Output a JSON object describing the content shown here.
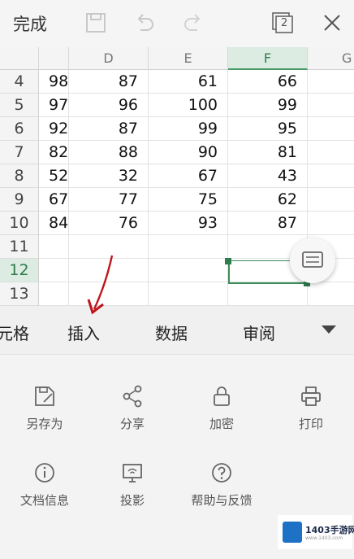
{
  "toolbar": {
    "done_label": "完成",
    "page_count": "2",
    "icons": [
      "save-icon",
      "undo-icon",
      "redo-icon",
      "pages-icon",
      "close-icon"
    ]
  },
  "sheet": {
    "columns": [
      "",
      "D",
      "E",
      "F",
      "G"
    ],
    "selected_column": "F",
    "selected_row": "12",
    "rows": [
      {
        "num": "4",
        "c": "98",
        "d": "87",
        "e": "61",
        "f": "66"
      },
      {
        "num": "5",
        "c": "97",
        "d": "96",
        "e": "100",
        "f": "99"
      },
      {
        "num": "6",
        "c": "92",
        "d": "87",
        "e": "99",
        "f": "95"
      },
      {
        "num": "7",
        "c": "82",
        "d": "88",
        "e": "90",
        "f": "81"
      },
      {
        "num": "8",
        "c": "52",
        "d": "32",
        "e": "67",
        "f": "43"
      },
      {
        "num": "9",
        "c": "67",
        "d": "77",
        "e": "75",
        "f": "62"
      },
      {
        "num": "10",
        "c": "84",
        "d": "76",
        "e": "93",
        "f": "87"
      },
      {
        "num": "11",
        "c": "",
        "d": "",
        "e": "",
        "f": ""
      },
      {
        "num": "12",
        "c": "",
        "d": "",
        "e": "",
        "f": ""
      },
      {
        "num": "13",
        "c": "",
        "d": "",
        "e": "",
        "f": ""
      }
    ]
  },
  "tabs": [
    "元格",
    "插入",
    "数据",
    "审阅"
  ],
  "menu": {
    "items": [
      {
        "label": "另存为",
        "icon": "save-as-icon"
      },
      {
        "label": "分享",
        "icon": "share-icon"
      },
      {
        "label": "加密",
        "icon": "lock-icon"
      },
      {
        "label": "打印",
        "icon": "print-icon"
      },
      {
        "label": "文档信息",
        "icon": "info-icon"
      },
      {
        "label": "投影",
        "icon": "projection-icon"
      },
      {
        "label": "帮助与反馈",
        "icon": "help-icon"
      }
    ]
  },
  "watermark": {
    "title": "1403手游网",
    "sub": "www.1403.com"
  },
  "colors": {
    "accent_green": "#3d8e5b",
    "arrow_red": "#c0141c",
    "brand_blue": "#1d72c5"
  }
}
